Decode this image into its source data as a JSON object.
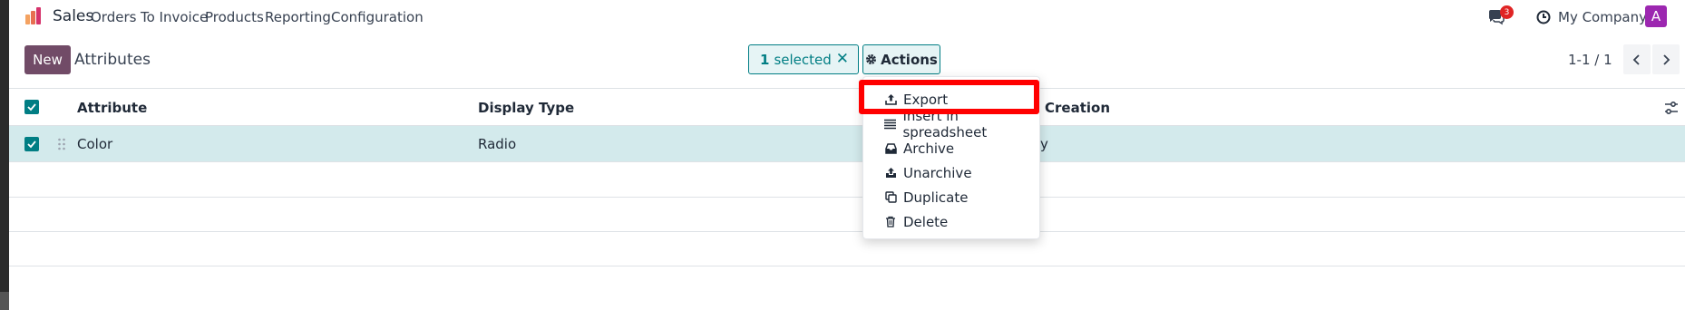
{
  "navbar": {
    "app_name": "Sales",
    "menu": [
      "Orders",
      "To Invoice",
      "Products",
      "Reporting",
      "Configuration"
    ],
    "chat_badge": "3",
    "company": "My Company",
    "avatar_letter": "A"
  },
  "control": {
    "new_label": "New",
    "title": "Attributes",
    "selected_count": "1",
    "selected_label": "selected",
    "actions_label": "Actions",
    "pager": "1-1 / 1"
  },
  "table": {
    "columns": [
      "Attribute",
      "Display Type",
      "Creation"
    ],
    "rows": [
      {
        "attribute": "Color",
        "display_type": "Radio",
        "creation": "y"
      }
    ]
  },
  "actions_menu": {
    "items": [
      {
        "label": "Export",
        "icon": "upload-icon"
      },
      {
        "label": "Insert in spreadsheet",
        "icon": "list-icon"
      },
      {
        "label": "Archive",
        "icon": "inbox-icon"
      },
      {
        "label": "Unarchive",
        "icon": "unarchive-icon"
      },
      {
        "label": "Duplicate",
        "icon": "copy-icon"
      },
      {
        "label": "Delete",
        "icon": "trash-icon"
      }
    ],
    "highlighted": "Export"
  },
  "colors": {
    "brand": "#714b67",
    "accent": "#017e84",
    "selected_row": "#d3eaec",
    "badge": "#e02424",
    "highlight": "#ff0000"
  }
}
